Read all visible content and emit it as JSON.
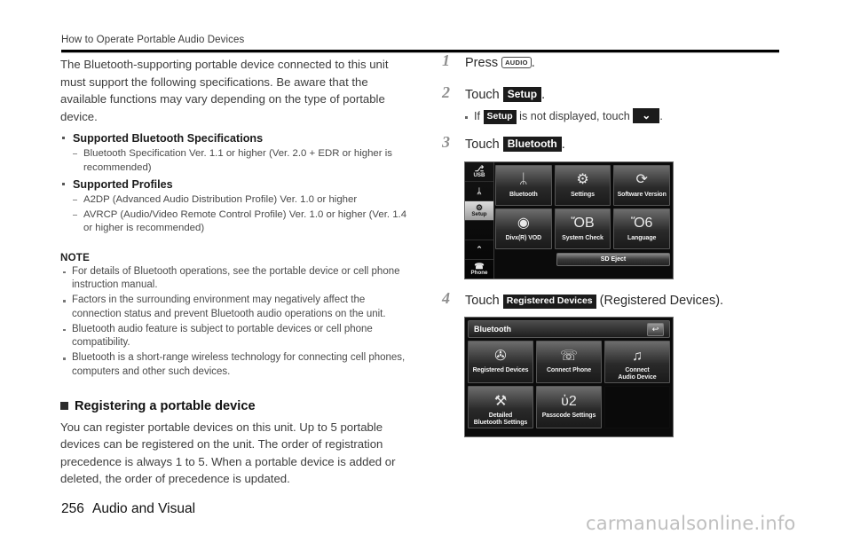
{
  "header": {
    "title": "How to Operate Portable Audio Devices"
  },
  "left": {
    "intro": "The Bluetooth-supporting portable device connected to this unit must support the following specifications. Be aware that the available functions may vary depending on the type of portable device.",
    "specs": [
      {
        "label": "Supported Bluetooth Specifications",
        "items": [
          "Bluetooth Specification Ver. 1.1 or higher (Ver. 2.0 + EDR or higher is recommended)"
        ]
      },
      {
        "label": "Supported Profiles",
        "items": [
          "A2DP (Advanced Audio Distribution Profile) Ver. 1.0 or higher",
          "AVRCP (Audio/Video Remote Control Profile) Ver. 1.0 or higher (Ver. 1.4 or higher is recommended)"
        ]
      }
    ],
    "note_heading": "NOTE",
    "notes": [
      "For details of Bluetooth operations, see the portable device or cell phone instruction manual.",
      "Factors in the surrounding environment may negatively affect the connection status and prevent Bluetooth audio operations on the unit.",
      "Bluetooth audio feature is subject to portable devices or cell phone compatibility.",
      "Bluetooth is a short-range wireless technology for connecting cell phones, computers and other such devices."
    ],
    "section_heading": "Registering a portable device",
    "section_body": "You can register portable devices on this unit. Up to 5 portable devices can be registered on the unit. The order of registration precedence is always 1 to 5. When a portable device is added or deleted, the order of precedence is updated."
  },
  "right": {
    "steps": [
      {
        "num": "1",
        "pre": "Press ",
        "key": "AUDIO",
        "post": "."
      },
      {
        "num": "2",
        "pre": "Touch ",
        "key": "Setup",
        "post": "."
      },
      {
        "num": "3",
        "pre": "Touch ",
        "key": "Bluetooth",
        "post": "."
      },
      {
        "num": "4",
        "pre": "Touch ",
        "key": "Registered Devices",
        "post": " (Registered Devices)."
      }
    ],
    "substep": {
      "pre": "If ",
      "key": "Setup",
      "mid": " is not displayed, touch ",
      "arrow": "⌄",
      "post": "."
    }
  },
  "screen_setup": {
    "sidebar": [
      {
        "label": "USB",
        "icon": "usb-icon",
        "glyph": "⎇",
        "active": false
      },
      {
        "label": "",
        "icon": "bluetooth-icon",
        "glyph": "ᛦ",
        "active": false
      },
      {
        "label": "Setup",
        "icon": "setup-gear-icon",
        "glyph": "⚙",
        "active": true
      },
      {
        "label": "",
        "icon": "blank-slot-icon",
        "glyph": "",
        "active": false
      },
      {
        "label": "",
        "icon": "chevron-up-icon",
        "glyph": "⌃",
        "active": false
      },
      {
        "label": "Phone",
        "icon": "phone-icon",
        "glyph": "☎",
        "active": false
      }
    ],
    "tiles": [
      {
        "label": "Bluetooth",
        "icon": "bluetooth-icon",
        "glyph": "ᛦ"
      },
      {
        "label": "Settings",
        "icon": "gear-wrench-icon",
        "glyph": "⚙"
      },
      {
        "label": "Software Version",
        "icon": "refresh-circle-icon",
        "glyph": "⟳"
      },
      {
        "label": "Divx(R) VOD",
        "icon": "disc-icon",
        "glyph": "◉"
      },
      {
        "label": "System Check",
        "icon": "checklist-icon",
        "glyph": "ὌB"
      },
      {
        "label": "Language",
        "icon": "book-icon",
        "glyph": "Ὅ6"
      }
    ],
    "eject_label": "SD Eject"
  },
  "screen_bluetooth": {
    "title": "Bluetooth",
    "back_icon": "back-arrow-icon",
    "back_glyph": "↩",
    "tiles": [
      {
        "label": "Registered Devices",
        "icon": "devices-list-icon",
        "glyph": "✇"
      },
      {
        "label": "Connect Phone",
        "icon": "cellphone-icon",
        "glyph": "☏"
      },
      {
        "label": "Connect\nAudio Device",
        "icon": "audio-device-icon",
        "glyph": "♫"
      },
      {
        "label": "Detailed\nBluetooth Settings",
        "icon": "tools-icon",
        "glyph": "⚒"
      },
      {
        "label": "Passcode Settings",
        "icon": "lock-icon",
        "glyph": "ὑ2"
      }
    ]
  },
  "footer": {
    "page_number": "256",
    "section": "Audio and Visual",
    "watermark": "carmanualsonline.info"
  }
}
